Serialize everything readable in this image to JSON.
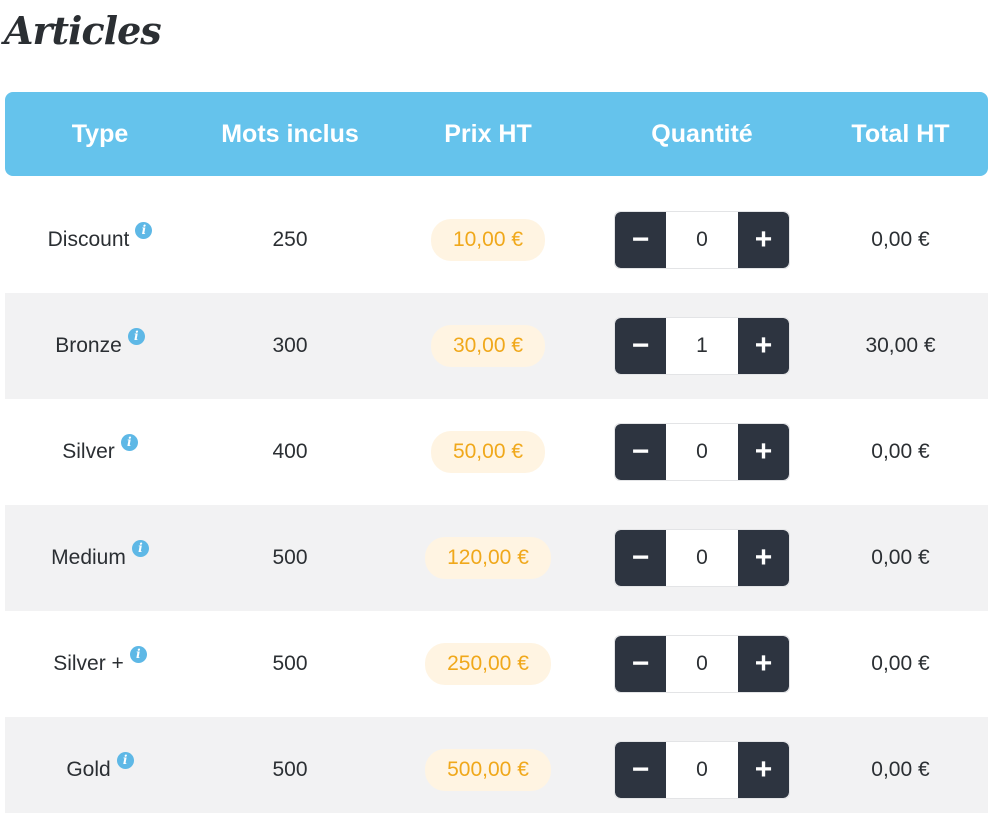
{
  "page": {
    "title": "Articles"
  },
  "colors": {
    "header_bg": "#65c3ec",
    "price_text": "#f0a81b",
    "price_bg": "#fff4e2",
    "stepper_dark": "#2d3440",
    "row_alt": "#f2f2f3",
    "info_icon": "#5eb8e6"
  },
  "icons": {
    "info": "info-icon",
    "minus": "minus-icon",
    "plus": "plus-icon"
  },
  "table": {
    "headers": [
      "Type",
      "Mots inclus",
      "Prix HT",
      "Quantité",
      "Total HT"
    ],
    "rows": [
      {
        "type": "Discount",
        "words": "250",
        "price": "10,00 €",
        "quantity": "0",
        "total": "0,00 €"
      },
      {
        "type": "Bronze",
        "words": "300",
        "price": "30,00 €",
        "quantity": "1",
        "total": "30,00 €"
      },
      {
        "type": "Silver",
        "words": "400",
        "price": "50,00 €",
        "quantity": "0",
        "total": "0,00 €"
      },
      {
        "type": "Medium",
        "words": "500",
        "price": "120,00 €",
        "quantity": "0",
        "total": "0,00 €"
      },
      {
        "type": "Silver +",
        "words": "500",
        "price": "250,00 €",
        "quantity": "0",
        "total": "0,00 €"
      },
      {
        "type": "Gold",
        "words": "500",
        "price": "500,00 €",
        "quantity": "0",
        "total": "0,00 €"
      }
    ],
    "stepper": {
      "minus_label": "−",
      "plus_label": "+"
    },
    "info_glyph": "i"
  }
}
